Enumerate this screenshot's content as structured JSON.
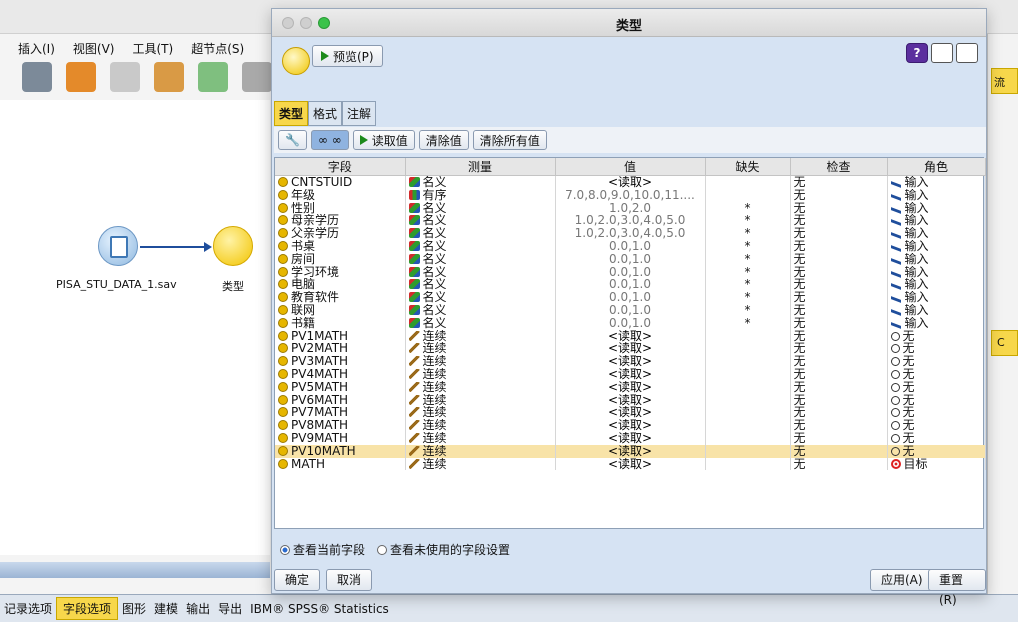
{
  "dialog": {
    "title": "类型",
    "preview_label": "预览(P)",
    "help_label": "?"
  },
  "menubar": {
    "items": [
      "插入(I)",
      "视图(V)",
      "工具(T)",
      "超节点(S)"
    ]
  },
  "canvas": {
    "source_label": "PISA_STU_DATA_1.sav",
    "type_label": "类型"
  },
  "tabs": {
    "items": [
      "类型",
      "格式",
      "注解"
    ]
  },
  "subtoolbar": {
    "read_values": "读取值",
    "clear_values": "清除值",
    "clear_all": "清除所有值"
  },
  "table": {
    "headers": [
      "字段",
      "测量",
      "值",
      "缺失",
      "检查",
      "角色"
    ],
    "rows": [
      {
        "field": "CNTSTUID",
        "measure": "名义",
        "mtype": "nom",
        "value": "<读取>",
        "vdark": true,
        "missing": "",
        "check": "无",
        "role": "输入",
        "rtype": "in"
      },
      {
        "field": "年级",
        "measure": "有序",
        "mtype": "ord",
        "value": "7.0,8.0,9.0,10.0,11....",
        "vdark": false,
        "missing": "",
        "check": "无",
        "role": "输入",
        "rtype": "in"
      },
      {
        "field": "性别",
        "measure": "名义",
        "mtype": "nom",
        "value": "1.0,2.0",
        "vdark": false,
        "missing": "*",
        "check": "无",
        "role": "输入",
        "rtype": "in"
      },
      {
        "field": "母亲学历",
        "measure": "名义",
        "mtype": "nom",
        "value": "1.0,2.0,3.0,4.0,5.0",
        "vdark": false,
        "missing": "*",
        "check": "无",
        "role": "输入",
        "rtype": "in"
      },
      {
        "field": "父亲学历",
        "measure": "名义",
        "mtype": "nom",
        "value": "1.0,2.0,3.0,4.0,5.0",
        "vdark": false,
        "missing": "*",
        "check": "无",
        "role": "输入",
        "rtype": "in"
      },
      {
        "field": "书桌",
        "measure": "名义",
        "mtype": "nom",
        "value": "0.0,1.0",
        "vdark": false,
        "missing": "*",
        "check": "无",
        "role": "输入",
        "rtype": "in"
      },
      {
        "field": "房间",
        "measure": "名义",
        "mtype": "nom",
        "value": "0.0,1.0",
        "vdark": false,
        "missing": "*",
        "check": "无",
        "role": "输入",
        "rtype": "in"
      },
      {
        "field": "学习环境",
        "measure": "名义",
        "mtype": "nom",
        "value": "0.0,1.0",
        "vdark": false,
        "missing": "*",
        "check": "无",
        "role": "输入",
        "rtype": "in"
      },
      {
        "field": "电脑",
        "measure": "名义",
        "mtype": "nom",
        "value": "0.0,1.0",
        "vdark": false,
        "missing": "*",
        "check": "无",
        "role": "输入",
        "rtype": "in"
      },
      {
        "field": "教育软件",
        "measure": "名义",
        "mtype": "nom",
        "value": "0.0,1.0",
        "vdark": false,
        "missing": "*",
        "check": "无",
        "role": "输入",
        "rtype": "in"
      },
      {
        "field": "联网",
        "measure": "名义",
        "mtype": "nom",
        "value": "0.0,1.0",
        "vdark": false,
        "missing": "*",
        "check": "无",
        "role": "输入",
        "rtype": "in"
      },
      {
        "field": "书籍",
        "measure": "名义",
        "mtype": "nom",
        "value": "0.0,1.0",
        "vdark": false,
        "missing": "*",
        "check": "无",
        "role": "输入",
        "rtype": "in"
      },
      {
        "field": "PV1MATH",
        "measure": "连续",
        "mtype": "con",
        "value": "<读取>",
        "vdark": true,
        "missing": "",
        "check": "无",
        "role": "无",
        "rtype": "none"
      },
      {
        "field": "PV2MATH",
        "measure": "连续",
        "mtype": "con",
        "value": "<读取>",
        "vdark": true,
        "missing": "",
        "check": "无",
        "role": "无",
        "rtype": "none"
      },
      {
        "field": "PV3MATH",
        "measure": "连续",
        "mtype": "con",
        "value": "<读取>",
        "vdark": true,
        "missing": "",
        "check": "无",
        "role": "无",
        "rtype": "none"
      },
      {
        "field": "PV4MATH",
        "measure": "连续",
        "mtype": "con",
        "value": "<读取>",
        "vdark": true,
        "missing": "",
        "check": "无",
        "role": "无",
        "rtype": "none"
      },
      {
        "field": "PV5MATH",
        "measure": "连续",
        "mtype": "con",
        "value": "<读取>",
        "vdark": true,
        "missing": "",
        "check": "无",
        "role": "无",
        "rtype": "none"
      },
      {
        "field": "PV6MATH",
        "measure": "连续",
        "mtype": "con",
        "value": "<读取>",
        "vdark": true,
        "missing": "",
        "check": "无",
        "role": "无",
        "rtype": "none"
      },
      {
        "field": "PV7MATH",
        "measure": "连续",
        "mtype": "con",
        "value": "<读取>",
        "vdark": true,
        "missing": "",
        "check": "无",
        "role": "无",
        "rtype": "none"
      },
      {
        "field": "PV8MATH",
        "measure": "连续",
        "mtype": "con",
        "value": "<读取>",
        "vdark": true,
        "missing": "",
        "check": "无",
        "role": "无",
        "rtype": "none"
      },
      {
        "field": "PV9MATH",
        "measure": "连续",
        "mtype": "con",
        "value": "<读取>",
        "vdark": true,
        "missing": "",
        "check": "无",
        "role": "无",
        "rtype": "none"
      },
      {
        "field": "PV10MATH",
        "measure": "连续",
        "mtype": "con",
        "value": "<读取>",
        "vdark": true,
        "missing": "",
        "check": "无",
        "role": "无",
        "rtype": "none",
        "selected": true
      },
      {
        "field": "MATH",
        "measure": "连续",
        "mtype": "con",
        "value": "<读取>",
        "vdark": true,
        "missing": "",
        "check": "无",
        "role": "目标",
        "rtype": "target"
      }
    ]
  },
  "view": {
    "current": "查看当前字段",
    "unused": "查看未使用的字段设置"
  },
  "footer": {
    "ok": "确定",
    "cancel": "取消",
    "apply": "应用(A)",
    "reset": "重置(R)"
  },
  "bottom_tabs": [
    "记录选项",
    "字段选项",
    "图形",
    "建模",
    "输出",
    "导出",
    "IBM® SPSS® Statistics"
  ],
  "right_tabs": [
    "流",
    "C"
  ]
}
